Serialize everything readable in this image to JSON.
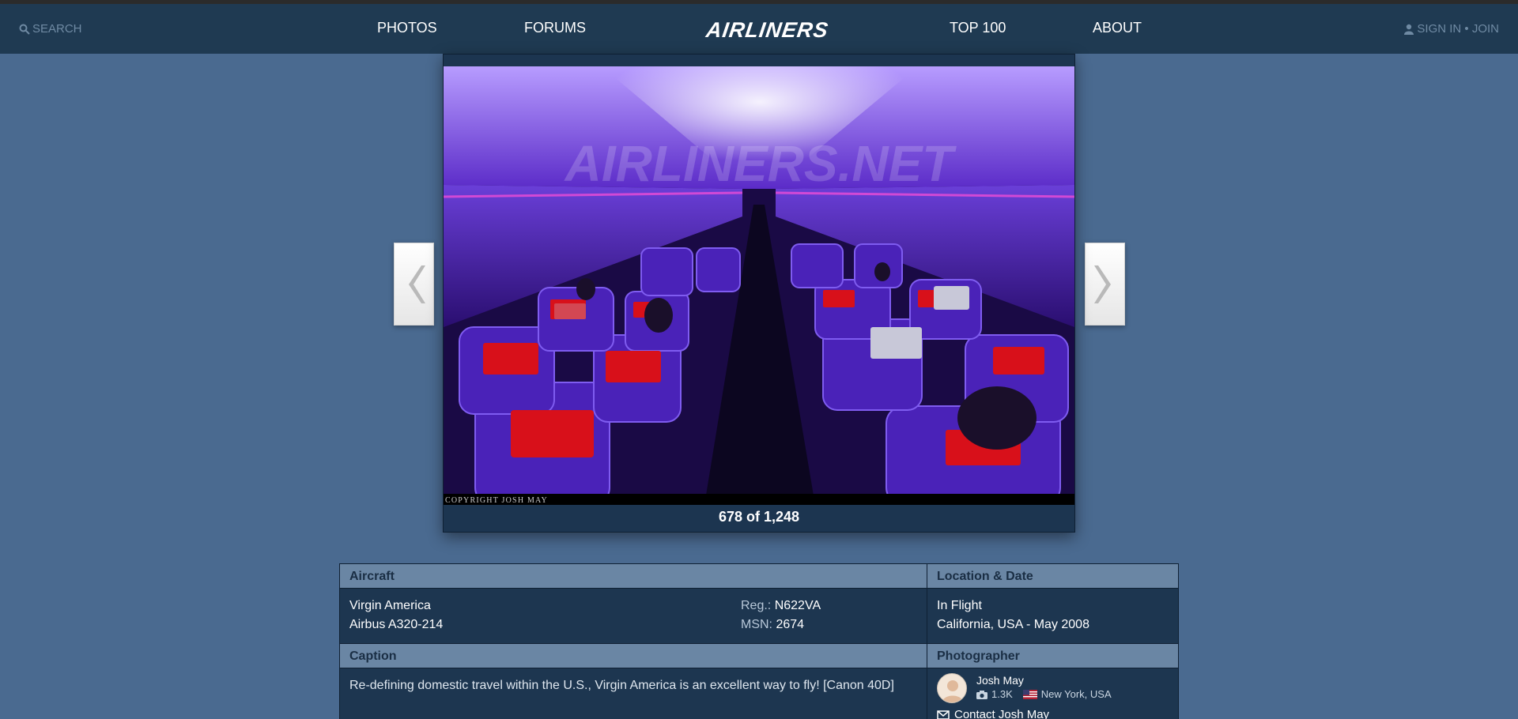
{
  "nav": {
    "search_label": "SEARCH",
    "photos": "PHOTOS",
    "forums": "FORUMS",
    "logo_text": "AIRLINERS",
    "top100": "TOP 100",
    "about": "ABOUT",
    "sign_in": "SIGN IN • JOIN"
  },
  "photo": {
    "counter": "678 of 1,248",
    "watermark": "AIRLINERS.NET",
    "copyright": "COPYRIGHT JOSH MAY",
    "prev_icon": "chevron-left-icon",
    "next_icon": "chevron-right-icon"
  },
  "aircraft": {
    "heading": "Aircraft",
    "airline": "Virgin America",
    "model": "Airbus A320-214",
    "reg_label": "Reg.:",
    "reg_value": "N622VA",
    "msn_label": "MSN:",
    "msn_value": "2674"
  },
  "location": {
    "heading": "Location & Date",
    "place": "In Flight",
    "region_date": "California, USA - May 2008"
  },
  "caption": {
    "heading": "Caption",
    "text": "Re-defining domestic travel within the U.S., Virgin America is an excellent way to fly! [Canon 40D]"
  },
  "photographer": {
    "heading": "Photographer",
    "name": "Josh May",
    "photo_count": "1.3K",
    "location": "New York, USA",
    "contact": "Contact Josh May"
  },
  "colors": {
    "nav_bg": "#1f3a52",
    "page_bg": "#4a6a90",
    "table_head": "#6a86a4",
    "table_body": "#1d3650"
  }
}
